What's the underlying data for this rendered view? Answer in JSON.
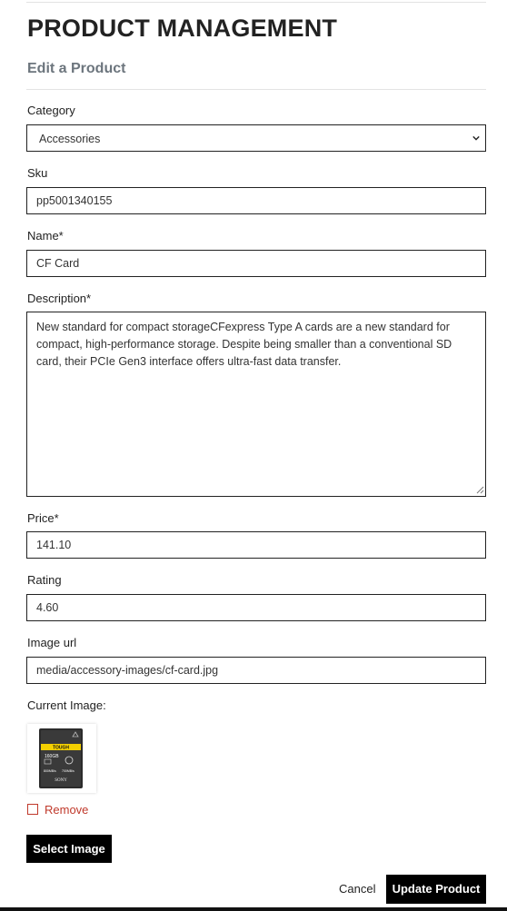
{
  "header": {
    "title": "PRODUCT MANAGEMENT",
    "subtitle": "Edit a Product"
  },
  "form": {
    "category": {
      "label": "Category",
      "value": "Accessories"
    },
    "sku": {
      "label": "Sku",
      "value": "pp5001340155"
    },
    "name": {
      "label": "Name*",
      "value": "CF Card"
    },
    "description": {
      "label": "Description*",
      "value": "New standard for compact storageCFexpress Type A cards are a new standard for compact, high-performance storage. Despite being smaller than a conventional SD card, their PCIe Gen3 interface offers ultra-fast data transfer."
    },
    "price": {
      "label": "Price*",
      "value": "141.10"
    },
    "rating": {
      "label": "Rating",
      "value": "4.60"
    },
    "image_url": {
      "label": "Image url",
      "value": "media/accessory-images/cf-card.jpg"
    },
    "current_image": {
      "label": "Current Image:",
      "card": {
        "band_text": "TOUGH",
        "capacity": "160GB",
        "speed_read": "800MB/s",
        "speed_write": "700MB/s",
        "brand": "SONY"
      }
    },
    "remove_label": "Remove",
    "select_image_label": "Select Image"
  },
  "actions": {
    "cancel_label": "Cancel",
    "update_label": "Update Product"
  },
  "colors": {
    "remove_red": "#c0392b",
    "button_black": "#000000",
    "card_yellow": "#f4d000"
  }
}
